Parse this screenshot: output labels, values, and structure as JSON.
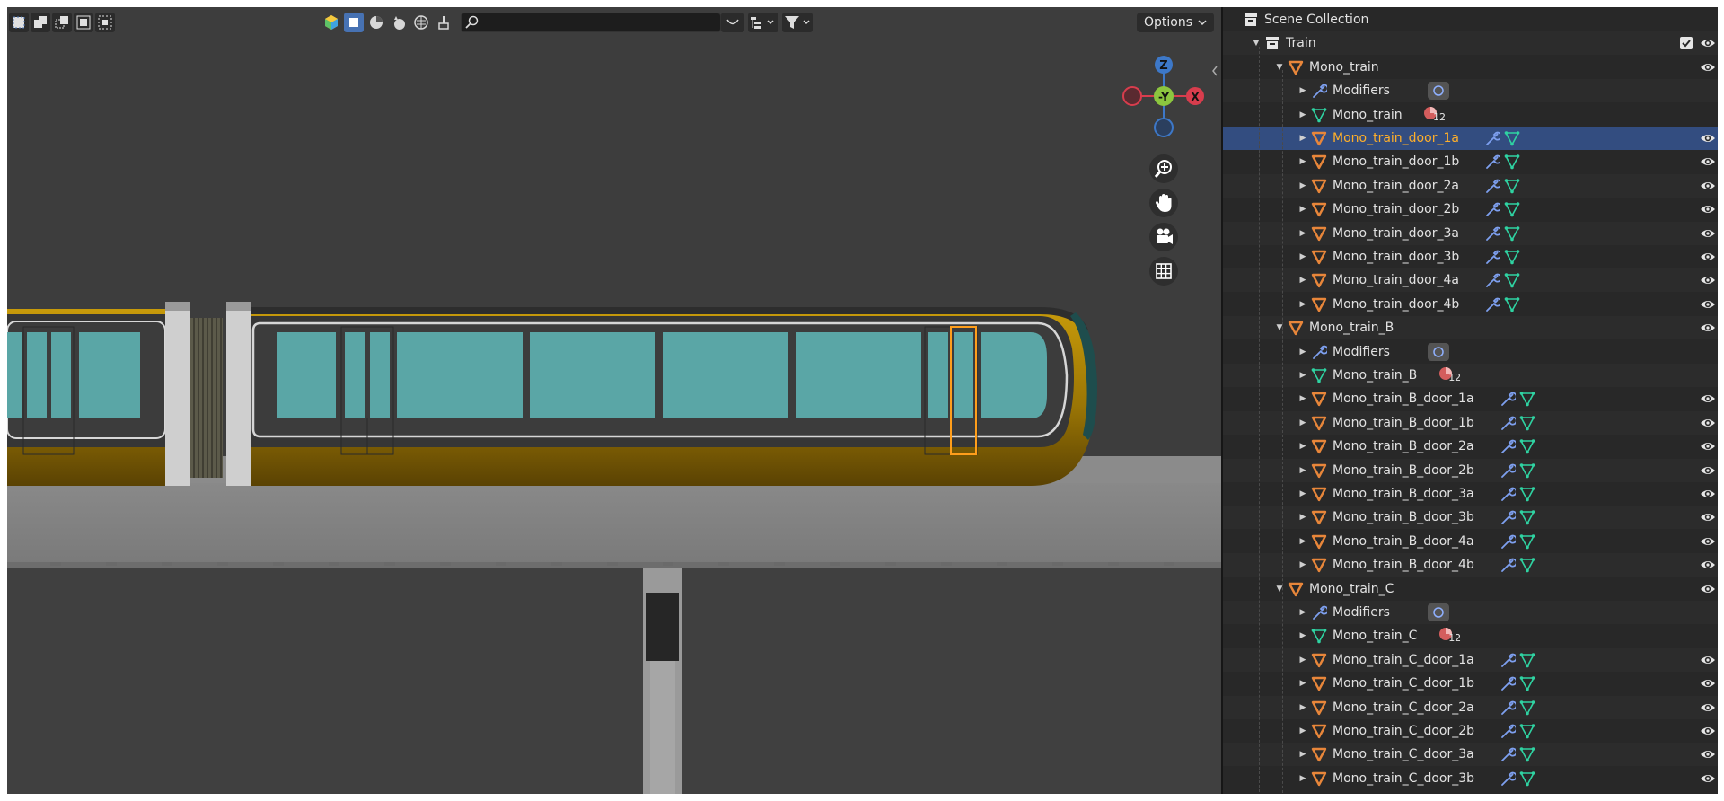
{
  "viewport": {
    "search": {
      "value": "",
      "placeholder": ""
    },
    "options_label": "Options",
    "mode_icons": [
      "select-box-icon",
      "select-extend-icon",
      "select-subtract-icon",
      "select-intersect-icon"
    ],
    "shading_icons": [
      "viewport-shading-icon",
      "solid-shading-icon",
      "material-shading-icon",
      "render-shading-icon",
      "wireframe-icon",
      "brush-icon"
    ],
    "gizmo": {
      "z": "Z",
      "neg_y": "-Y",
      "x": "X"
    },
    "nav_icons": [
      "zoom-icon",
      "pan-hand-icon",
      "camera-icon",
      "grid-icon"
    ],
    "colors": {
      "viewport_bg": "#3d3d3d",
      "train_body": "#a07a08",
      "window": "#5aa6a6",
      "selection": "#ff9e1b",
      "platform": "#858585"
    }
  },
  "outliner": {
    "root": "Scene Collection",
    "collection": "Train",
    "badge_count": "12",
    "groups": [
      {
        "name": "Mono_train",
        "children": [
          {
            "kind": "modifiers",
            "label": "Modifiers"
          },
          {
            "kind": "mesh",
            "label": "Mono_train"
          },
          {
            "kind": "object",
            "label": "Mono_train_door_1a",
            "selected": true
          },
          {
            "kind": "object",
            "label": "Mono_train_door_1b"
          },
          {
            "kind": "object",
            "label": "Mono_train_door_2a"
          },
          {
            "kind": "object",
            "label": "Mono_train_door_2b"
          },
          {
            "kind": "object",
            "label": "Mono_train_door_3a"
          },
          {
            "kind": "object",
            "label": "Mono_train_door_3b"
          },
          {
            "kind": "object",
            "label": "Mono_train_door_4a"
          },
          {
            "kind": "object",
            "label": "Mono_train_door_4b"
          }
        ]
      },
      {
        "name": "Mono_train_B",
        "children": [
          {
            "kind": "modifiers",
            "label": "Modifiers"
          },
          {
            "kind": "mesh",
            "label": "Mono_train_B"
          },
          {
            "kind": "object",
            "label": "Mono_train_B_door_1a"
          },
          {
            "kind": "object",
            "label": "Mono_train_B_door_1b"
          },
          {
            "kind": "object",
            "label": "Mono_train_B_door_2a"
          },
          {
            "kind": "object",
            "label": "Mono_train_B_door_2b"
          },
          {
            "kind": "object",
            "label": "Mono_train_B_door_3a"
          },
          {
            "kind": "object",
            "label": "Mono_train_B_door_3b"
          },
          {
            "kind": "object",
            "label": "Mono_train_B_door_4a"
          },
          {
            "kind": "object",
            "label": "Mono_train_B_door_4b"
          }
        ]
      },
      {
        "name": "Mono_train_C",
        "children": [
          {
            "kind": "modifiers",
            "label": "Modifiers"
          },
          {
            "kind": "mesh",
            "label": "Mono_train_C"
          },
          {
            "kind": "object",
            "label": "Mono_train_C_door_1a"
          },
          {
            "kind": "object",
            "label": "Mono_train_C_door_1b"
          },
          {
            "kind": "object",
            "label": "Mono_train_C_door_2a"
          },
          {
            "kind": "object",
            "label": "Mono_train_C_door_2b"
          },
          {
            "kind": "object",
            "label": "Mono_train_C_door_3a"
          },
          {
            "kind": "object",
            "label": "Mono_train_C_door_3b"
          }
        ]
      }
    ]
  }
}
